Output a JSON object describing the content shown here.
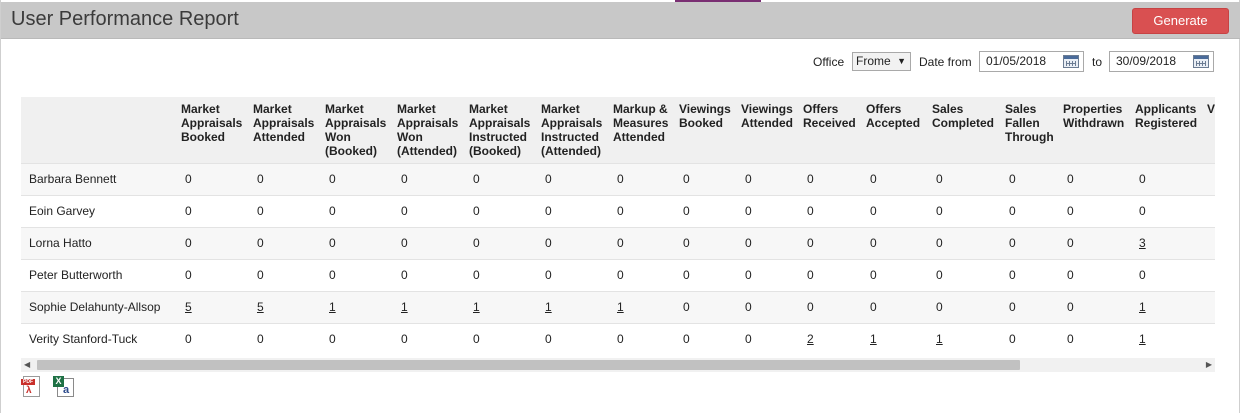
{
  "header": {
    "title": "User Performance Report",
    "generate_label": "Generate"
  },
  "filters": {
    "office_label": "Office",
    "office_value": "Frome",
    "date_from_label": "Date from",
    "date_from_value": "01/05/2018",
    "to_label": "to",
    "date_to_value": "30/09/2018"
  },
  "table": {
    "columns": [
      "Market Appraisals Booked",
      "Market Appraisals Attended",
      "Market Appraisals Won (Booked)",
      "Market Appraisals Won (Attended)",
      "Market Appraisals Instructed (Booked)",
      "Market Appraisals Instructed (Attended)",
      "Markup & Measures Attended",
      "Viewings Booked",
      "Viewings Attended",
      "Offers Received",
      "Offers Accepted",
      "Sales Completed",
      "Sales Fallen Through",
      "Properties Withdrawn",
      "Applicants Registered",
      "V C C"
    ],
    "rows": [
      {
        "name": "Barbara Bennett",
        "values": [
          "0",
          "0",
          "0",
          "0",
          "0",
          "0",
          "0",
          "0",
          "0",
          "0",
          "0",
          "0",
          "0",
          "0",
          "0",
          ""
        ],
        "links": [
          false,
          false,
          false,
          false,
          false,
          false,
          false,
          false,
          false,
          false,
          false,
          false,
          false,
          false,
          false,
          false
        ]
      },
      {
        "name": "Eoin Garvey",
        "values": [
          "0",
          "0",
          "0",
          "0",
          "0",
          "0",
          "0",
          "0",
          "0",
          "0",
          "0",
          "0",
          "0",
          "0",
          "0",
          ""
        ],
        "links": [
          false,
          false,
          false,
          false,
          false,
          false,
          false,
          false,
          false,
          false,
          false,
          false,
          false,
          false,
          false,
          false
        ]
      },
      {
        "name": "Lorna Hatto",
        "values": [
          "0",
          "0",
          "0",
          "0",
          "0",
          "0",
          "0",
          "0",
          "0",
          "0",
          "0",
          "0",
          "0",
          "0",
          "3",
          ""
        ],
        "links": [
          false,
          false,
          false,
          false,
          false,
          false,
          false,
          false,
          false,
          false,
          false,
          false,
          false,
          false,
          true,
          false
        ]
      },
      {
        "name": "Peter Butterworth",
        "values": [
          "0",
          "0",
          "0",
          "0",
          "0",
          "0",
          "0",
          "0",
          "0",
          "0",
          "0",
          "0",
          "0",
          "0",
          "0",
          ""
        ],
        "links": [
          false,
          false,
          false,
          false,
          false,
          false,
          false,
          false,
          false,
          false,
          false,
          false,
          false,
          false,
          false,
          false
        ]
      },
      {
        "name": "Sophie Delahunty-Allsop",
        "values": [
          "5",
          "5",
          "1",
          "1",
          "1",
          "1",
          "1",
          "0",
          "0",
          "0",
          "0",
          "0",
          "0",
          "0",
          "1",
          ""
        ],
        "links": [
          true,
          true,
          true,
          true,
          true,
          true,
          true,
          false,
          false,
          false,
          false,
          false,
          false,
          false,
          true,
          false
        ]
      },
      {
        "name": "Verity Stanford-Tuck",
        "values": [
          "0",
          "0",
          "0",
          "0",
          "0",
          "0",
          "0",
          "0",
          "0",
          "2",
          "1",
          "1",
          "0",
          "0",
          "1",
          ""
        ],
        "links": [
          false,
          false,
          false,
          false,
          false,
          false,
          false,
          false,
          false,
          true,
          true,
          true,
          false,
          false,
          true,
          false
        ]
      }
    ]
  },
  "icons": {
    "pdf": "pdf-export-icon",
    "excel": "excel-export-icon",
    "calendar": "calendar-icon"
  },
  "colors": {
    "header_bg": "#c8c8c8",
    "generate_btn": "#d95051",
    "accent": "#7a2f73"
  }
}
